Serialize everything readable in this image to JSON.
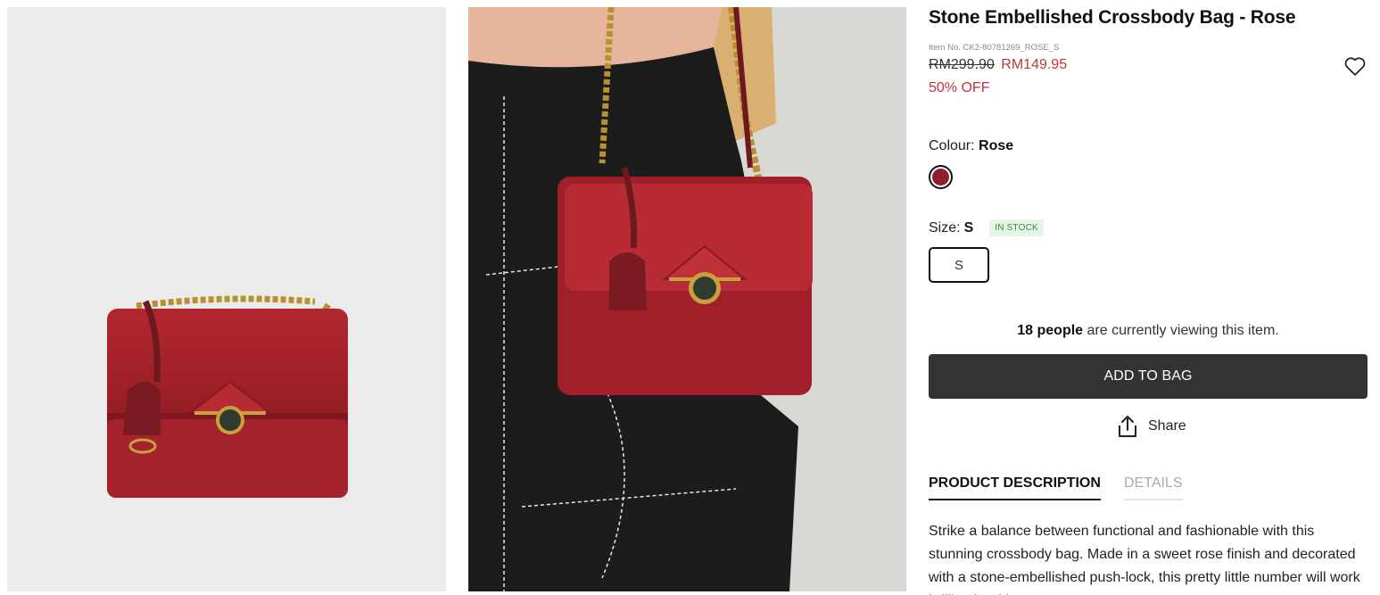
{
  "product": {
    "title": "Stone Embellished Crossbody Bag - Rose",
    "item_no": "Item No. CK2-80781269_ROSE_S",
    "original_price": "RM299.90",
    "sale_price": "RM149.95",
    "discount": "50% OFF"
  },
  "colour": {
    "label": "Colour:",
    "value": "Rose",
    "swatch_color": "#8f1f2c"
  },
  "size": {
    "label": "Size:",
    "value": "S",
    "stock": "IN STOCK",
    "options": [
      "S"
    ]
  },
  "viewing": {
    "count": "18 people",
    "suffix": " are currently viewing this item."
  },
  "actions": {
    "add_to_bag": "ADD TO BAG",
    "share": "Share"
  },
  "tabs": [
    {
      "label": "PRODUCT DESCRIPTION"
    },
    {
      "label": "DETAILS"
    }
  ],
  "description": "Strike a balance between functional and fashionable with this stunning crossbody bag. Made in a sweet rose finish and decorated with a stone-embellished push-lock, this pretty little number will work brilliantly with a",
  "colors": {
    "accent_red": "#c4343c",
    "button_dark": "#333333",
    "bag_red": "#a8222e"
  },
  "icons": [
    "heart-icon",
    "share-icon"
  ]
}
